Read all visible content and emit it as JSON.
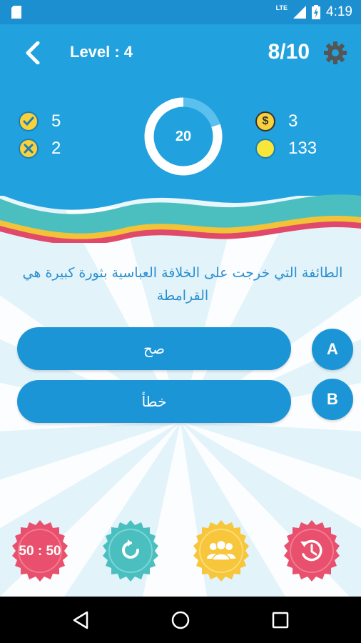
{
  "status_bar": {
    "network": "LTE",
    "time": "4:19"
  },
  "header": {
    "level_label": "Level : 4",
    "progress": "8/10"
  },
  "stats": {
    "correct": "5",
    "wrong": "2",
    "timer": "20",
    "timer_fraction": 0.8,
    "coins_dollar": "3",
    "coins_total": "133"
  },
  "question": {
    "text": "الطائفة التي خرجت على الخلافة العباسية بثورة كبيرة هي القرامطة"
  },
  "answers": [
    {
      "letter": "A",
      "text": "صح"
    },
    {
      "letter": "B",
      "text": "خطأ"
    }
  ],
  "lifelines": [
    {
      "label": "50 : 50",
      "color": "#e8506d"
    },
    {
      "icon": "refresh-icon",
      "color": "#4bbfbf"
    },
    {
      "icon": "audience-icon",
      "color": "#f7c63a"
    },
    {
      "icon": "clock-rewind-icon",
      "color": "#e8506d"
    }
  ],
  "colors": {
    "primary": "#21a2de",
    "answer_bg": "#1c95d6",
    "question_text": "#2a8fcf",
    "status_bar": "#1c8fd0"
  }
}
